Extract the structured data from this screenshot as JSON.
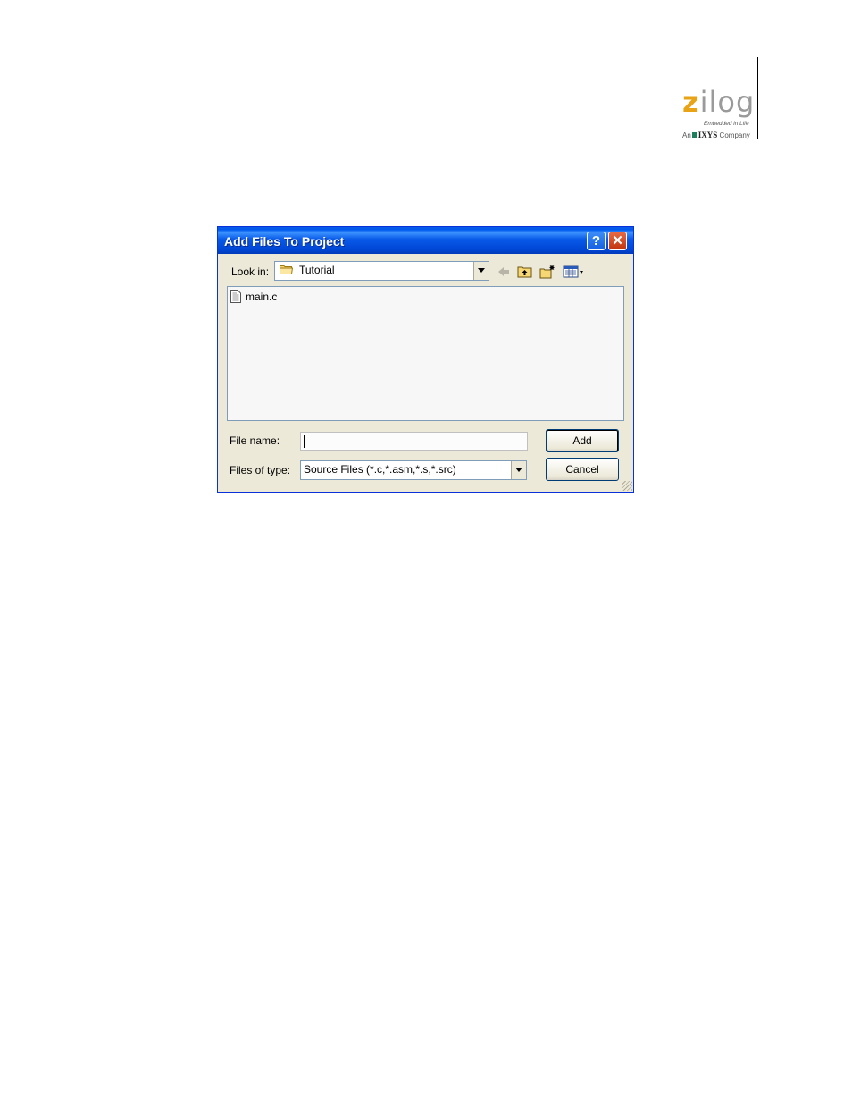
{
  "logo": {
    "brand_first": "z",
    "brand_rest": "ilog",
    "tagline": "Embedded in Life",
    "company_an": "An",
    "company_name": "IXYS",
    "company_word": "Company"
  },
  "dialog": {
    "title": "Add Files To Project",
    "help_button": "?",
    "close_button": "✕",
    "look_in_label": "Look in:",
    "look_in_value": "Tutorial",
    "toolbar_icons": [
      "back-arrow-icon",
      "up-folder-icon",
      "new-folder-icon",
      "view-menu-icon"
    ],
    "files": [
      {
        "name": "main.c",
        "icon": "c-file-icon"
      }
    ],
    "file_name_label": "File name:",
    "file_name_value": "",
    "files_of_type_label": "Files of type:",
    "files_of_type_value": "Source Files (*.c,*.asm,*.s,*.src)",
    "add_button": "Add",
    "cancel_button": "Cancel"
  },
  "colors": {
    "titlebar": "#0058ee",
    "dialog_face": "#ece9d8",
    "logo_accent": "#e8a317",
    "logo_grey": "#9a9a9a"
  }
}
